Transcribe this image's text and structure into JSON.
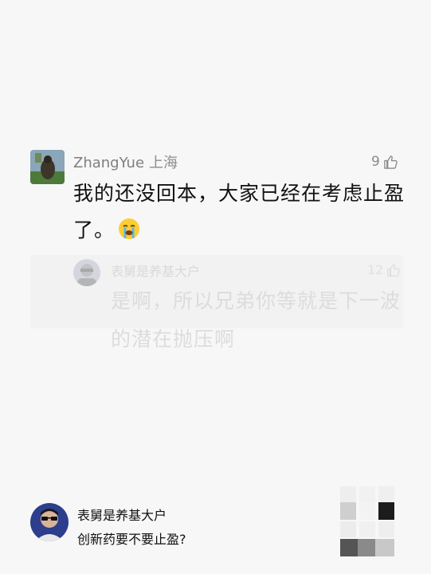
{
  "comment": {
    "username": "ZhangYue",
    "location": "上海",
    "likes": "9",
    "text": "我的还没回本，大家已经在考虑止盈了。",
    "emoji": "crying-face"
  },
  "reply": {
    "username": "表舅是养基大户",
    "likes": "12",
    "text": "是啊，所以兄弟你等就是下一波的潜在抛压啊"
  },
  "footer": {
    "author": "表舅是养基大户",
    "question": "创新药要不要止盈?"
  },
  "icons": {
    "like": "thumbs-up-icon"
  },
  "colors": {
    "background": "#f7f7f7",
    "primary_text": "#111111",
    "secondary_text": "#7f7f7f",
    "faded_text": "#dcdcdc"
  }
}
